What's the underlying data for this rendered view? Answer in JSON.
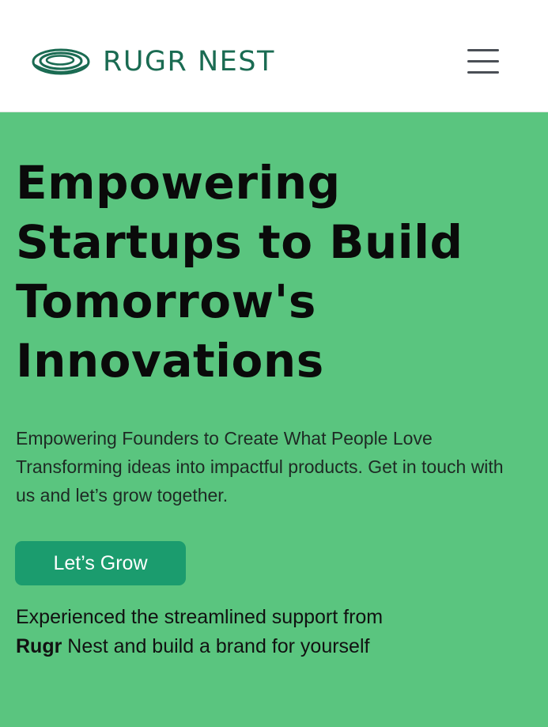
{
  "header": {
    "brand_name": "RUGR NEST",
    "logo_icon": "ringed-nest-logo",
    "menu_icon": "hamburger-menu-icon"
  },
  "hero": {
    "title": "Empowering Startups to Build Tomorrow's Innovations",
    "subtitle_line1": "Empowering Founders to Create What People Love",
    "subtitle_line2": "Transforming ideas into impactful products. Get in touch with us and let’s grow together.",
    "cta_label": "Let’s Grow",
    "note_prefix": "Experienced the streamlined support from",
    "note_brand": "Rugr",
    "note_suffix": "Nest and build a brand for yourself"
  },
  "colors": {
    "brand": "#1a6b52",
    "hero_background": "#5ac57f",
    "cta_background": "#1b9c6e",
    "menu_icon": "#4a4f55"
  }
}
